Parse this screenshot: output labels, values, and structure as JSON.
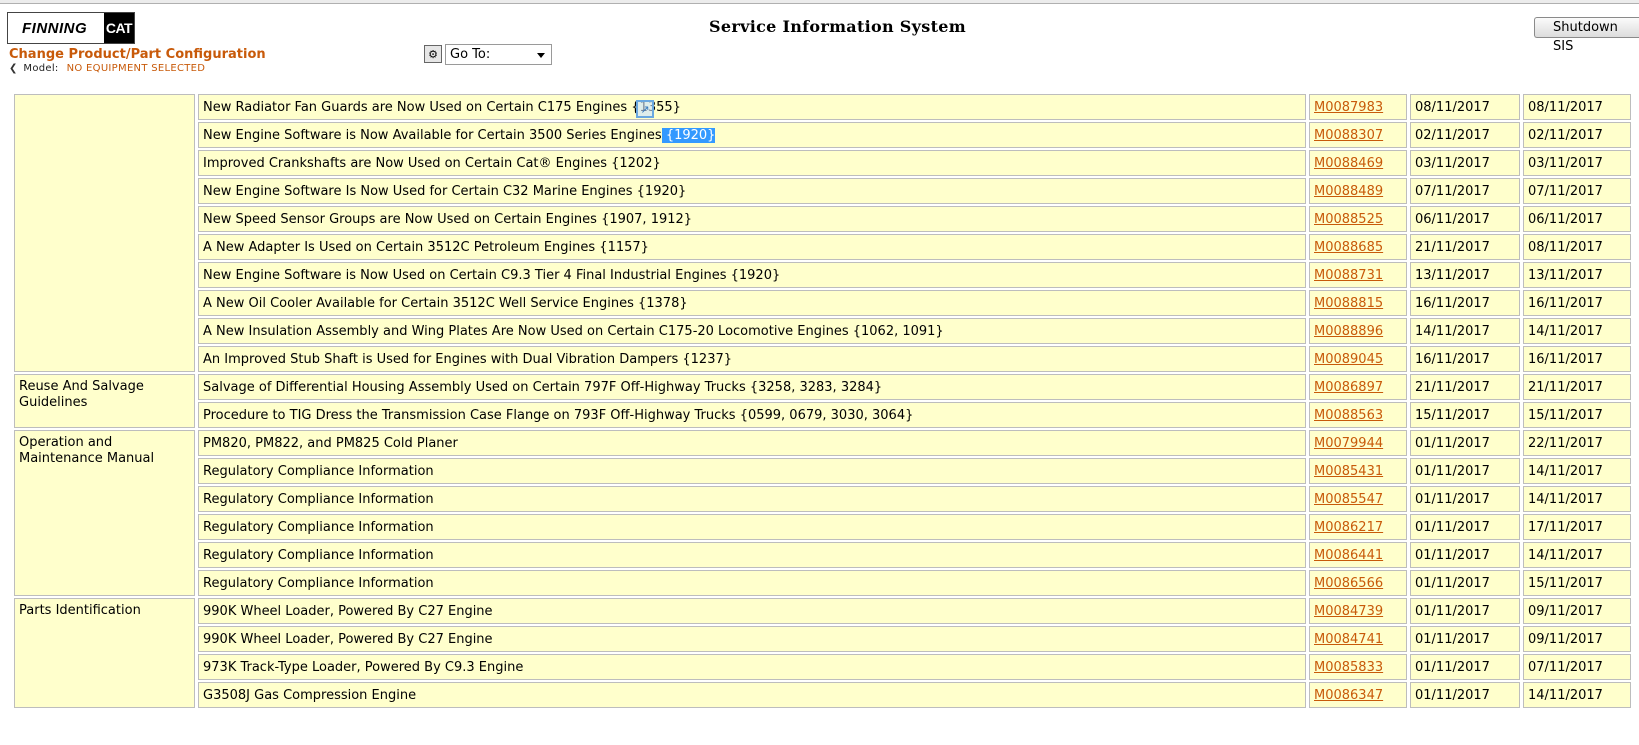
{
  "header": {
    "logo_finning": "FINNING",
    "logo_cat": "CAT",
    "app_title": "Service Information System",
    "shutdown_label": "Shutdown SIS",
    "change_link": "Change Product/Part Configuration",
    "model_label": "Model:",
    "model_value": "NO EQUIPMENT SELECTED",
    "goto_label": "Go To:"
  },
  "rows": [
    {
      "category": "",
      "title": "New Radiator Fan Guards are Now Used on Certain C175 Engines {1355}",
      "mnum": "M0087983",
      "date1": "08/11/2017",
      "date2": "08/11/2017"
    },
    {
      "category": "",
      "title": "New Engine Software is Now Available for Certain 3500 Series Engines",
      "title_highlight": " {1920} ",
      "mnum": "M0088307",
      "date1": "02/11/2017",
      "date2": "02/11/2017"
    },
    {
      "category": "",
      "title": "Improved Crankshafts are Now Used on Certain Cat® Engines {1202}",
      "mnum": "M0088469",
      "date1": "03/11/2017",
      "date2": "03/11/2017"
    },
    {
      "category": "",
      "title": "New Engine Software Is Now Used for Certain C32 Marine Engines {1920}",
      "mnum": "M0088489",
      "date1": "07/11/2017",
      "date2": "07/11/2017"
    },
    {
      "category": "",
      "title": "New Speed Sensor Groups are Now Used on Certain Engines {1907, 1912}",
      "mnum": "M0088525",
      "date1": "06/11/2017",
      "date2": "06/11/2017"
    },
    {
      "category": "",
      "title": "A New Adapter Is Used on Certain 3512C Petroleum Engines {1157}",
      "mnum": "M0088685",
      "date1": "21/11/2017",
      "date2": "08/11/2017"
    },
    {
      "category": "",
      "title": "New Engine Software is Now Used on Certain C9.3 Tier 4 Final Industrial Engines {1920}",
      "mnum": "M0088731",
      "date1": "13/11/2017",
      "date2": "13/11/2017"
    },
    {
      "category": "",
      "title": "A New Oil Cooler Available for Certain 3512C Well Service Engines {1378}",
      "mnum": "M0088815",
      "date1": "16/11/2017",
      "date2": "16/11/2017"
    },
    {
      "category": "",
      "title": "A New Insulation Assembly and Wing Plates Are Now Used on Certain C175-20 Locomotive Engines {1062, 1091}",
      "mnum": "M0088896",
      "date1": "14/11/2017",
      "date2": "14/11/2017"
    },
    {
      "category": "",
      "title": "An Improved Stub Shaft is Used for Engines with Dual Vibration Dampers {1237}",
      "mnum": "M0089045",
      "date1": "16/11/2017",
      "date2": "16/11/2017"
    },
    {
      "category": "Reuse And Salvage Guidelines",
      "title": "Salvage of Differential Housing Assembly Used on Certain 797F Off-Highway Trucks {3258, 3283, 3284}",
      "mnum": "M0086897",
      "date1": "21/11/2017",
      "date2": "21/11/2017"
    },
    {
      "category": "",
      "title": "Procedure to TIG Dress the Transmission Case Flange on 793F Off-Highway Trucks {0599, 0679, 3030, 3064}",
      "mnum": "M0088563",
      "date1": "15/11/2017",
      "date2": "15/11/2017"
    },
    {
      "category": "Operation and Maintenance Manual",
      "title": "PM820, PM822, and PM825 Cold Planer",
      "mnum": "M0079944",
      "date1": "01/11/2017",
      "date2": "22/11/2017"
    },
    {
      "category": "",
      "title": "Regulatory Compliance Information",
      "mnum": "M0085431",
      "date1": "01/11/2017",
      "date2": "14/11/2017"
    },
    {
      "category": "",
      "title": "Regulatory Compliance Information",
      "mnum": "M0085547",
      "date1": "01/11/2017",
      "date2": "14/11/2017"
    },
    {
      "category": "",
      "title": "Regulatory Compliance Information",
      "mnum": "M0086217",
      "date1": "01/11/2017",
      "date2": "17/11/2017"
    },
    {
      "category": "",
      "title": "Regulatory Compliance Information",
      "mnum": "M0086441",
      "date1": "01/11/2017",
      "date2": "14/11/2017"
    },
    {
      "category": "",
      "title": "Regulatory Compliance Information",
      "mnum": "M0086566",
      "date1": "01/11/2017",
      "date2": "15/11/2017"
    },
    {
      "category": "Parts Identification",
      "title": "990K Wheel Loader, Powered By C27 Engine",
      "mnum": "M0084739",
      "date1": "01/11/2017",
      "date2": "09/11/2017"
    },
    {
      "category": "",
      "title": "990K Wheel Loader, Powered By C27 Engine",
      "mnum": "M0084741",
      "date1": "01/11/2017",
      "date2": "09/11/2017"
    },
    {
      "category": "",
      "title": "973K Track-Type Loader, Powered By C9.3 Engine",
      "mnum": "M0085833",
      "date1": "01/11/2017",
      "date2": "07/11/2017"
    },
    {
      "category": "",
      "title": "G3508J Gas Compression Engine",
      "mnum": "M0086347",
      "date1": "01/11/2017",
      "date2": "14/11/2017"
    }
  ]
}
